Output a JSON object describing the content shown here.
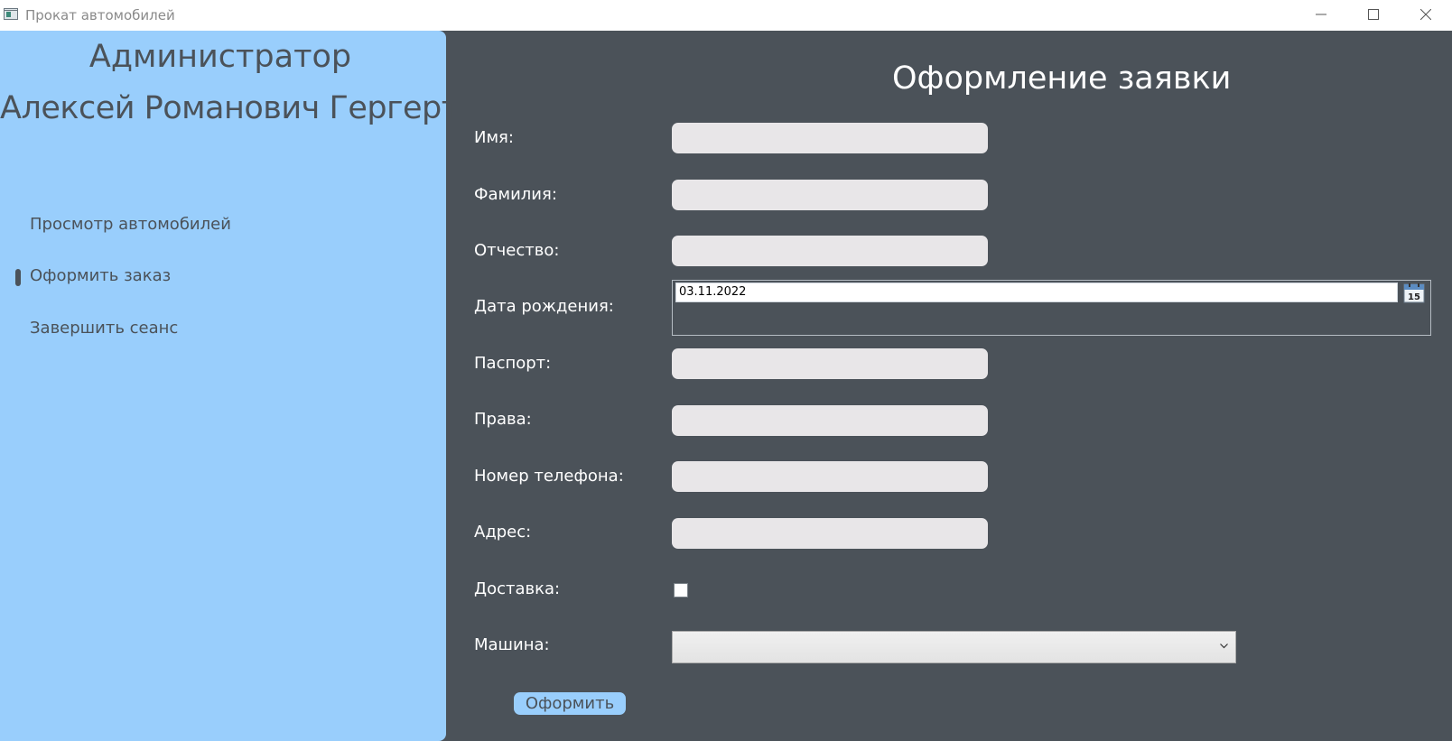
{
  "window": {
    "title": "Прокат автомобилей"
  },
  "sidebar": {
    "role": "Администратор",
    "username": "Алексей Романович Гергерт",
    "nav": [
      {
        "label": "Просмотр автомобилей",
        "active": false
      },
      {
        "label": "Оформить заказ",
        "active": true
      },
      {
        "label": "Завершить сеанс",
        "active": false
      }
    ]
  },
  "form": {
    "title": "Оформление заявки",
    "fields": {
      "first_name": {
        "label": "Имя:",
        "value": ""
      },
      "last_name": {
        "label": "Фамилия:",
        "value": ""
      },
      "patronymic": {
        "label": "Отчество:",
        "value": ""
      },
      "birth_date": {
        "label": "Дата рождения:",
        "value": "03.11.2022",
        "calendar_day": "15"
      },
      "passport": {
        "label": "Паспорт:",
        "value": ""
      },
      "license": {
        "label": "Права:",
        "value": ""
      },
      "phone": {
        "label": "Номер телефона:",
        "value": ""
      },
      "address": {
        "label": "Адрес:",
        "value": ""
      },
      "delivery": {
        "label": "Доставка:",
        "checked": false
      },
      "car": {
        "label": "Машина:",
        "selected": ""
      }
    },
    "submit_label": "Оформить"
  },
  "colors": {
    "sidebar_bg": "#99cefc",
    "main_bg": "#4b5259",
    "input_bg": "#e8e6e8",
    "accent_text": "#4b5259"
  }
}
